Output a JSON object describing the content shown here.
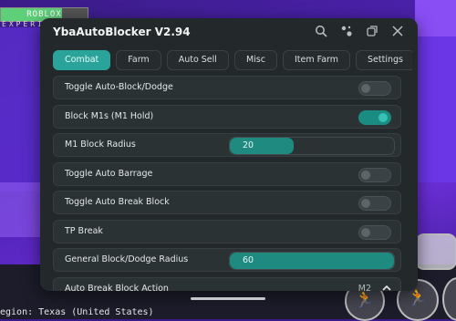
{
  "hud": {
    "bar_text": "ROBLOX",
    "label": "EXPERI"
  },
  "region_text": "egion: Texas (United States)",
  "window": {
    "title": "YbaAutoBlocker V2.94",
    "icons": [
      "search-icon",
      "settings-icon",
      "restore-icon",
      "close-icon"
    ]
  },
  "tabs": [
    {
      "label": "Combat",
      "active": true
    },
    {
      "label": "Farm",
      "active": false
    },
    {
      "label": "Auto Sell",
      "active": false
    },
    {
      "label": "Misc",
      "active": false
    },
    {
      "label": "Item Farm",
      "active": false
    },
    {
      "label": "Settings",
      "active": false
    }
  ],
  "rows": [
    {
      "type": "toggle",
      "label": "Toggle Auto-Block/Dodge",
      "on": false
    },
    {
      "type": "toggle",
      "label": "Block M1s (M1 Hold)",
      "on": true
    },
    {
      "type": "slider",
      "label": "M1 Block Radius",
      "value": "20",
      "fraction": 0.39
    },
    {
      "type": "toggle",
      "label": "Toggle Auto Barrage",
      "on": false
    },
    {
      "type": "toggle",
      "label": "Toggle Auto Break Block",
      "on": false
    },
    {
      "type": "toggle",
      "label": "TP Break",
      "on": false
    },
    {
      "type": "slider",
      "label": "General Block/Dodge Radius",
      "value": "60",
      "fraction": 1.0
    },
    {
      "type": "dropdown",
      "label": "Auto Break Block Action",
      "value": "M2"
    }
  ],
  "colors": {
    "accent": "#2aa49a",
    "window_bg": "#23282a",
    "row_bg": "#2b3234"
  }
}
